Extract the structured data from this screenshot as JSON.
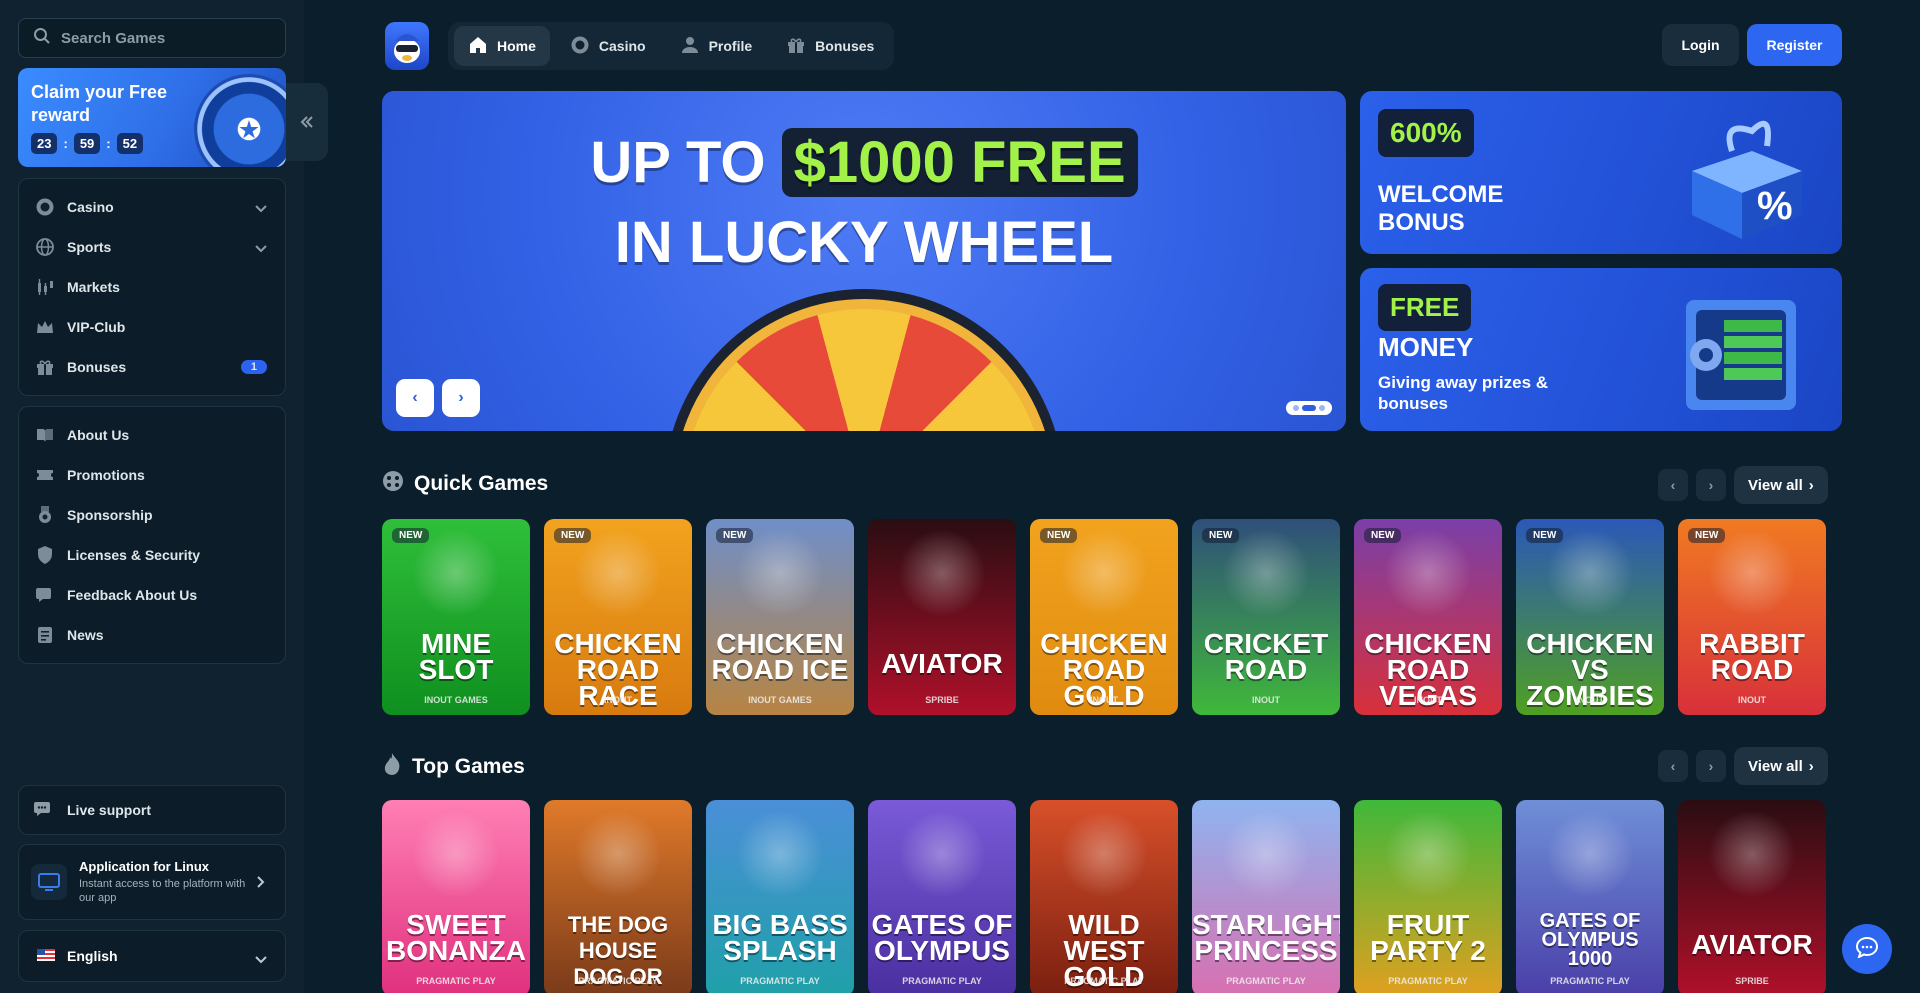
{
  "search": {
    "placeholder": "Search Games"
  },
  "promo": {
    "title": "Claim your Free reward",
    "timer": [
      "23",
      "59",
      "52"
    ]
  },
  "nav": {
    "main": [
      {
        "label": "Casino",
        "icon": "casino-chip-icon",
        "dropdown": true
      },
      {
        "label": "Sports",
        "icon": "globe-icon",
        "dropdown": true
      },
      {
        "label": "Markets",
        "icon": "candlestick-icon"
      },
      {
        "label": "VIP-Club",
        "icon": "crown-icon"
      },
      {
        "label": "Bonuses",
        "icon": "gift-icon",
        "badge": "1"
      }
    ],
    "info": [
      {
        "label": "About Us",
        "icon": "book-icon"
      },
      {
        "label": "Promotions",
        "icon": "ticket-icon"
      },
      {
        "label": "Sponsorship",
        "icon": "medal-icon"
      },
      {
        "label": "Licenses & Security",
        "icon": "shield-icon"
      },
      {
        "label": "Feedback About Us",
        "icon": "feedback-icon"
      },
      {
        "label": "News",
        "icon": "newspaper-icon"
      }
    ]
  },
  "support": {
    "label": "Live support"
  },
  "app": {
    "title": "Application for Linux",
    "desc": "Instant access to the platform with our app"
  },
  "language": {
    "label": "English"
  },
  "header": {
    "tabs": [
      {
        "label": "Home",
        "icon": "home-icon",
        "active": true
      },
      {
        "label": "Casino",
        "icon": "casino-chip-icon"
      },
      {
        "label": "Profile",
        "icon": "user-icon"
      },
      {
        "label": "Bonuses",
        "icon": "gift-icon"
      }
    ],
    "login": "Login",
    "register": "Register"
  },
  "hero": {
    "line1_prefix": "UP TO",
    "line1_highlight": "$1000 FREE",
    "line2": "IN LUCKY WHEEL"
  },
  "side_banners": [
    {
      "pill": "600%",
      "text": "WELCOME BONUS"
    },
    {
      "pill": "FREE",
      "text": "MONEY",
      "sub": "Giving away prizes & bonuses"
    }
  ],
  "sections": {
    "quick": {
      "title": "Quick Games",
      "view_all": "View all"
    },
    "top": {
      "title": "Top Games",
      "view_all": "View all"
    }
  },
  "quick_games": [
    {
      "name": "MINE\nSLOT",
      "provider": "INOUT GAMES",
      "new": "NEW",
      "bg": "#2fbf3a",
      "bg2": "#0f8f1f"
    },
    {
      "name": "CHICKEN\nROAD RACE",
      "provider": "INOUT",
      "new": "NEW",
      "bg": "#f2a31e",
      "bg2": "#d77a0f"
    },
    {
      "name": "CHICKEN\nROAD ICE",
      "provider": "INOUT GAMES",
      "new": "NEW",
      "bg": "#6f8fc9",
      "bg2": "#b78442"
    },
    {
      "name": "AVIATOR",
      "provider": "SPRIBE",
      "new": "",
      "bg": "#2a0d12",
      "bg2": "#b0102a"
    },
    {
      "name": "CHICKEN\nROAD GOLD",
      "provider": "INOUT",
      "new": "NEW",
      "bg": "#f2a31e",
      "bg2": "#e08b10"
    },
    {
      "name": "CRICKET\nROAD",
      "provider": "INOUT",
      "new": "NEW",
      "bg": "#2f4f7a",
      "bg2": "#3fb83a"
    },
    {
      "name": "CHICKEN\nROAD VEGAS",
      "provider": "INOUT",
      "new": "NEW",
      "bg": "#7a3fa8",
      "bg2": "#d8303a"
    },
    {
      "name": "CHICKEN\nVS ZOMBIES",
      "provider": "INOUT",
      "new": "NEW",
      "bg": "#2b58b8",
      "bg2": "#4fa022"
    },
    {
      "name": "RABBIT\nROAD",
      "provider": "INOUT",
      "new": "NEW",
      "bg": "#f07a22",
      "bg2": "#d8303a"
    }
  ],
  "top_games": [
    {
      "name": "SWEET\nBONANZA",
      "provider": "PRAGMATIC PLAY",
      "bg": "#ff7fb4",
      "bg2": "#e0307e"
    },
    {
      "name": "THE DOG HOUSE\nDOG OR ALIVE",
      "provider": "PRAGMATIC PLAY",
      "bg": "#e07a2a",
      "bg2": "#7a3a1a"
    },
    {
      "name": "BIG BASS\nSPLASH",
      "provider": "PRAGMATIC PLAY",
      "bg": "#4a8fd8",
      "bg2": "#1fa0a8"
    },
    {
      "name": "GATES OF\nOLYMPUS",
      "provider": "PRAGMATIC PLAY",
      "bg": "#7a5ad8",
      "bg2": "#4a2fa0"
    },
    {
      "name": "WILD WEST\nGOLD",
      "provider": "PRAGMATIC PLAY",
      "bg": "#d8502a",
      "bg2": "#7a1f10"
    },
    {
      "name": "STARLIGHT\nPRINCESS",
      "provider": "PRAGMATIC PLAY",
      "bg": "#8fb4f0",
      "bg2": "#d86fb0"
    },
    {
      "name": "FRUIT\nPARTY 2",
      "provider": "PRAGMATIC PLAY",
      "bg": "#3fb83a",
      "bg2": "#e0a020"
    },
    {
      "name": "GATES OF\nOLYMPUS\n1000",
      "provider": "PRAGMATIC PLAY",
      "bg": "#6f8fd8",
      "bg2": "#4a3fa8"
    },
    {
      "name": "AVIATOR",
      "provider": "SPRIBE",
      "bg": "#2a0d12",
      "bg2": "#b0102a"
    }
  ],
  "colors": {
    "accent": "#2d67f1",
    "lime": "#a3f24a",
    "bg": "#0b1e2b",
    "sidebar": "#10222f"
  }
}
